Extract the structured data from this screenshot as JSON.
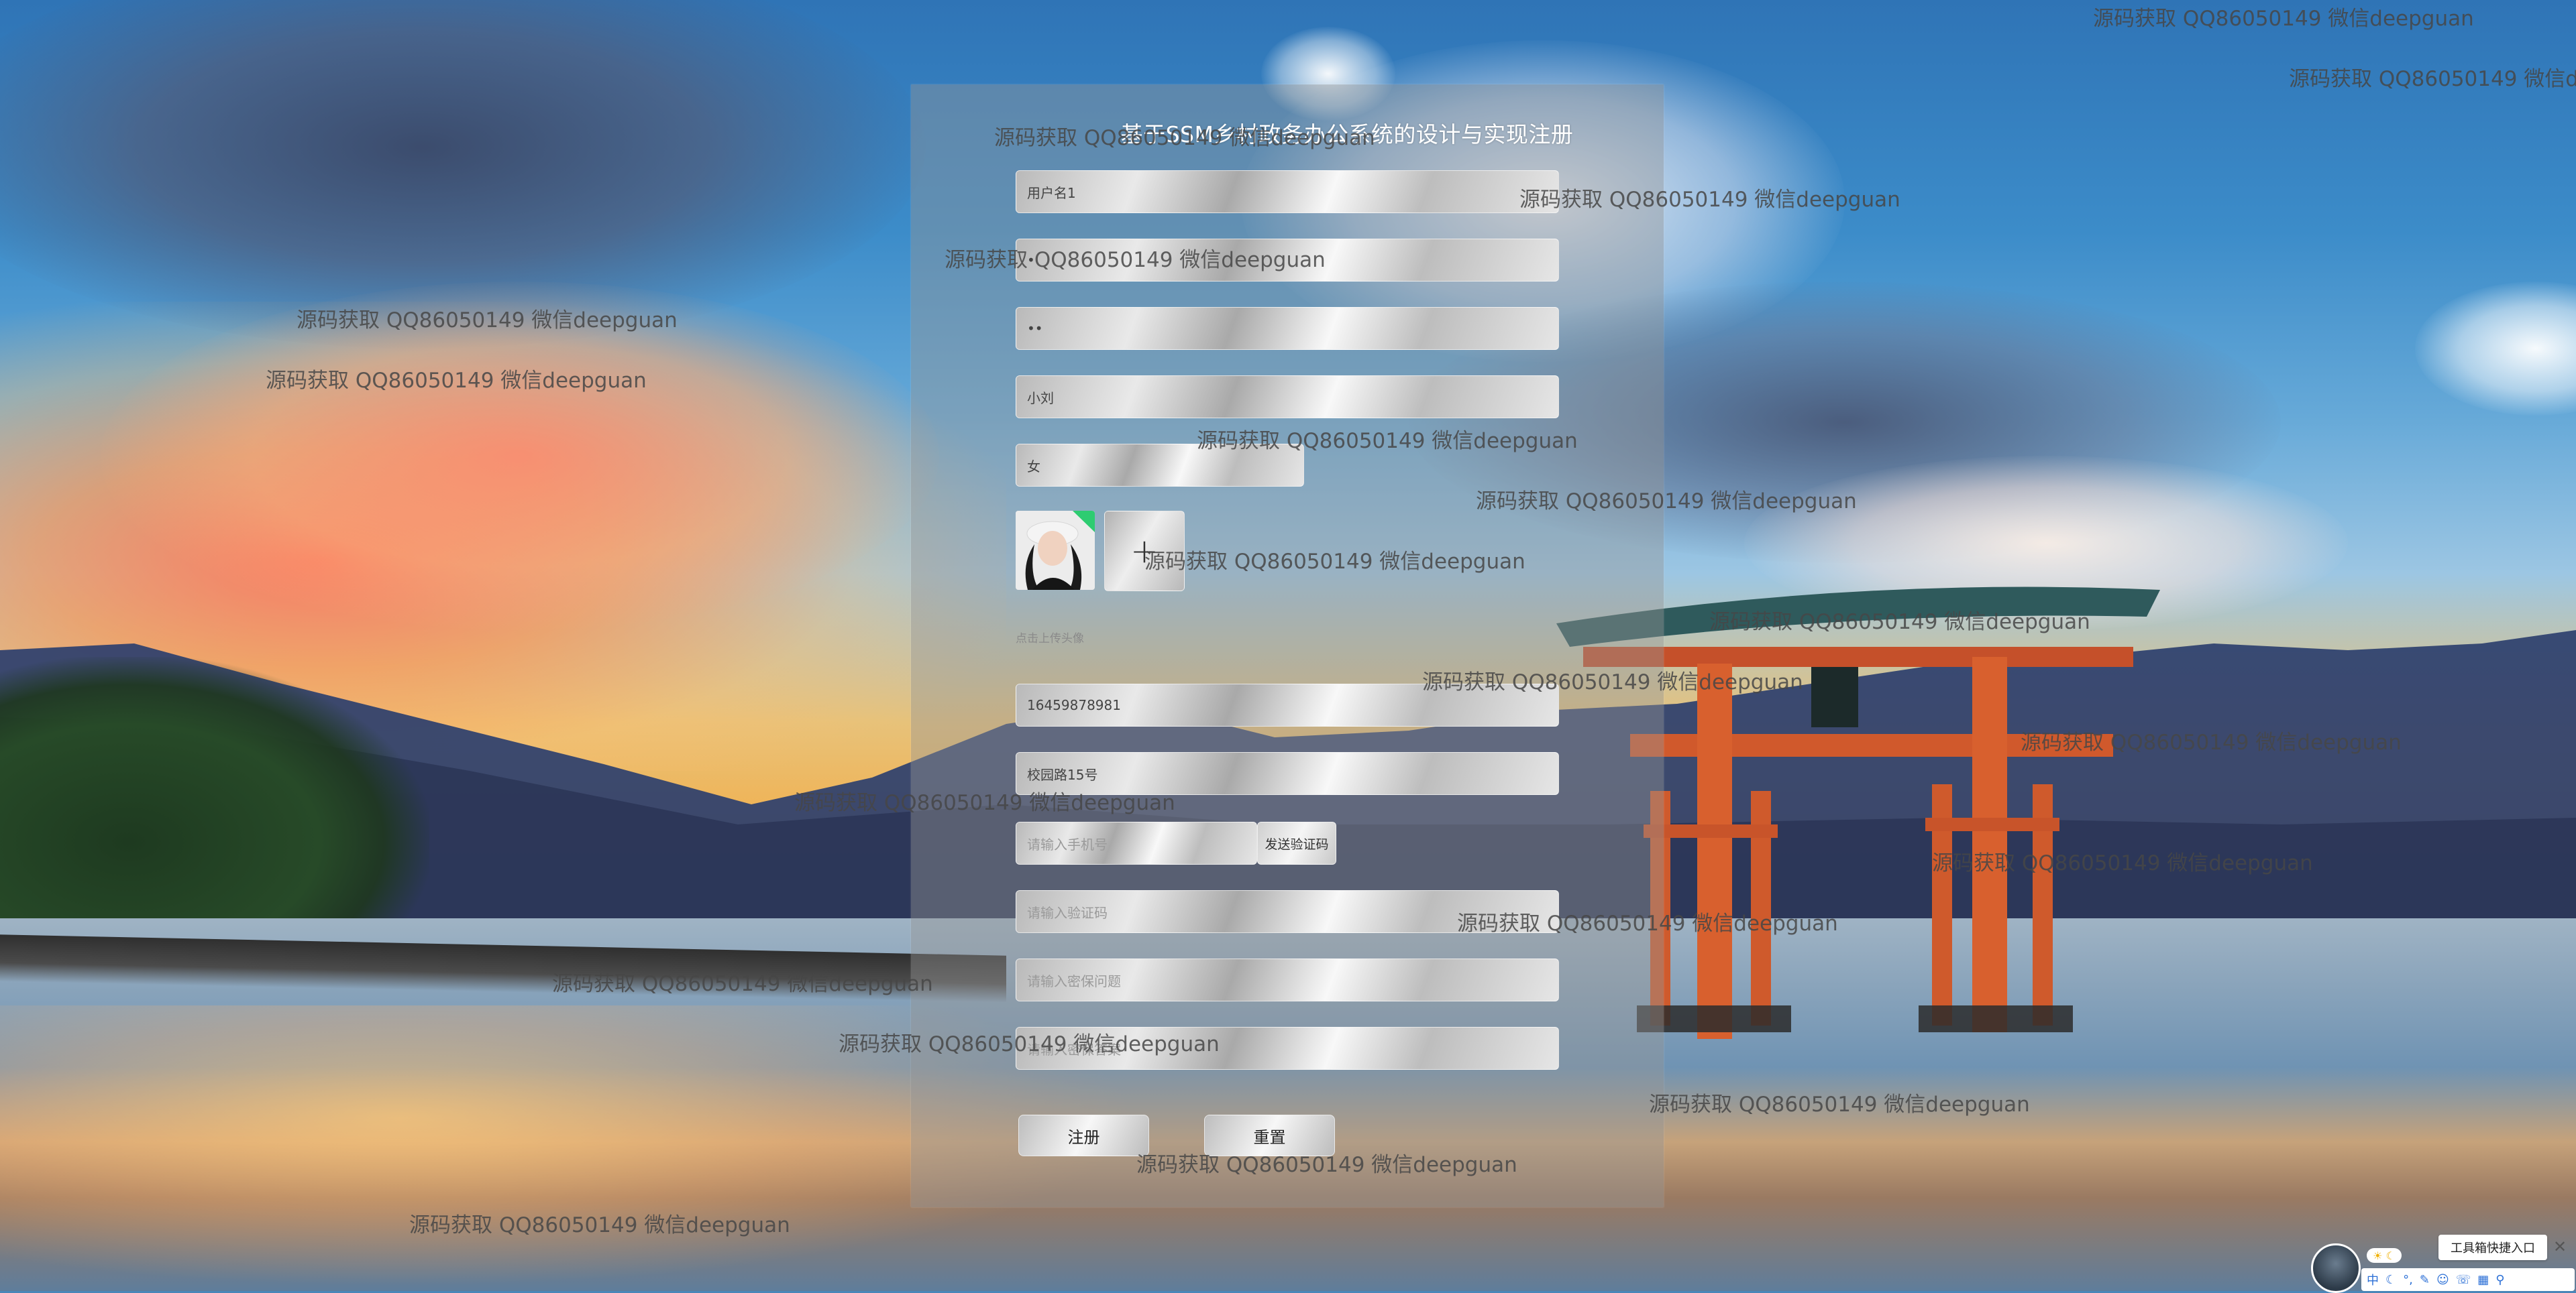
{
  "form": {
    "title": "基于SSM乡村政务办公系统的设计与实现注册",
    "username_value": "用户名1",
    "password_value": "•",
    "confirm_password_value": "••",
    "name_value": "小刘",
    "gender_value": "女",
    "avatar_upload_glyph": "+",
    "upload_hint": "点击上传头像",
    "phone_value": "16459878981",
    "address_value": "校园路15号",
    "sms_phone_placeholder": "请输入手机号",
    "send_code_label": "发送验证码",
    "verify_code_placeholder": "请输入验证码",
    "field_placeholder_2": "请输入密保问题",
    "field_placeholder_3": "请输入密保答案",
    "register_label": "注册",
    "reset_label": "重置"
  },
  "watermark": "源码获取 QQ86050149 微信deepguan",
  "floating_toolbar": {
    "tag_label": "工具箱快捷入口",
    "close_glyph": "✕",
    "bubble_glyph": "☀ ☾",
    "ime_items": [
      "中",
      "☾",
      "°,",
      "✎",
      "☺",
      "☏",
      "▦",
      "⚲"
    ]
  },
  "colors": {
    "panel": "#969696",
    "title_text": "#ffffff",
    "watermark_text": "#464646"
  }
}
